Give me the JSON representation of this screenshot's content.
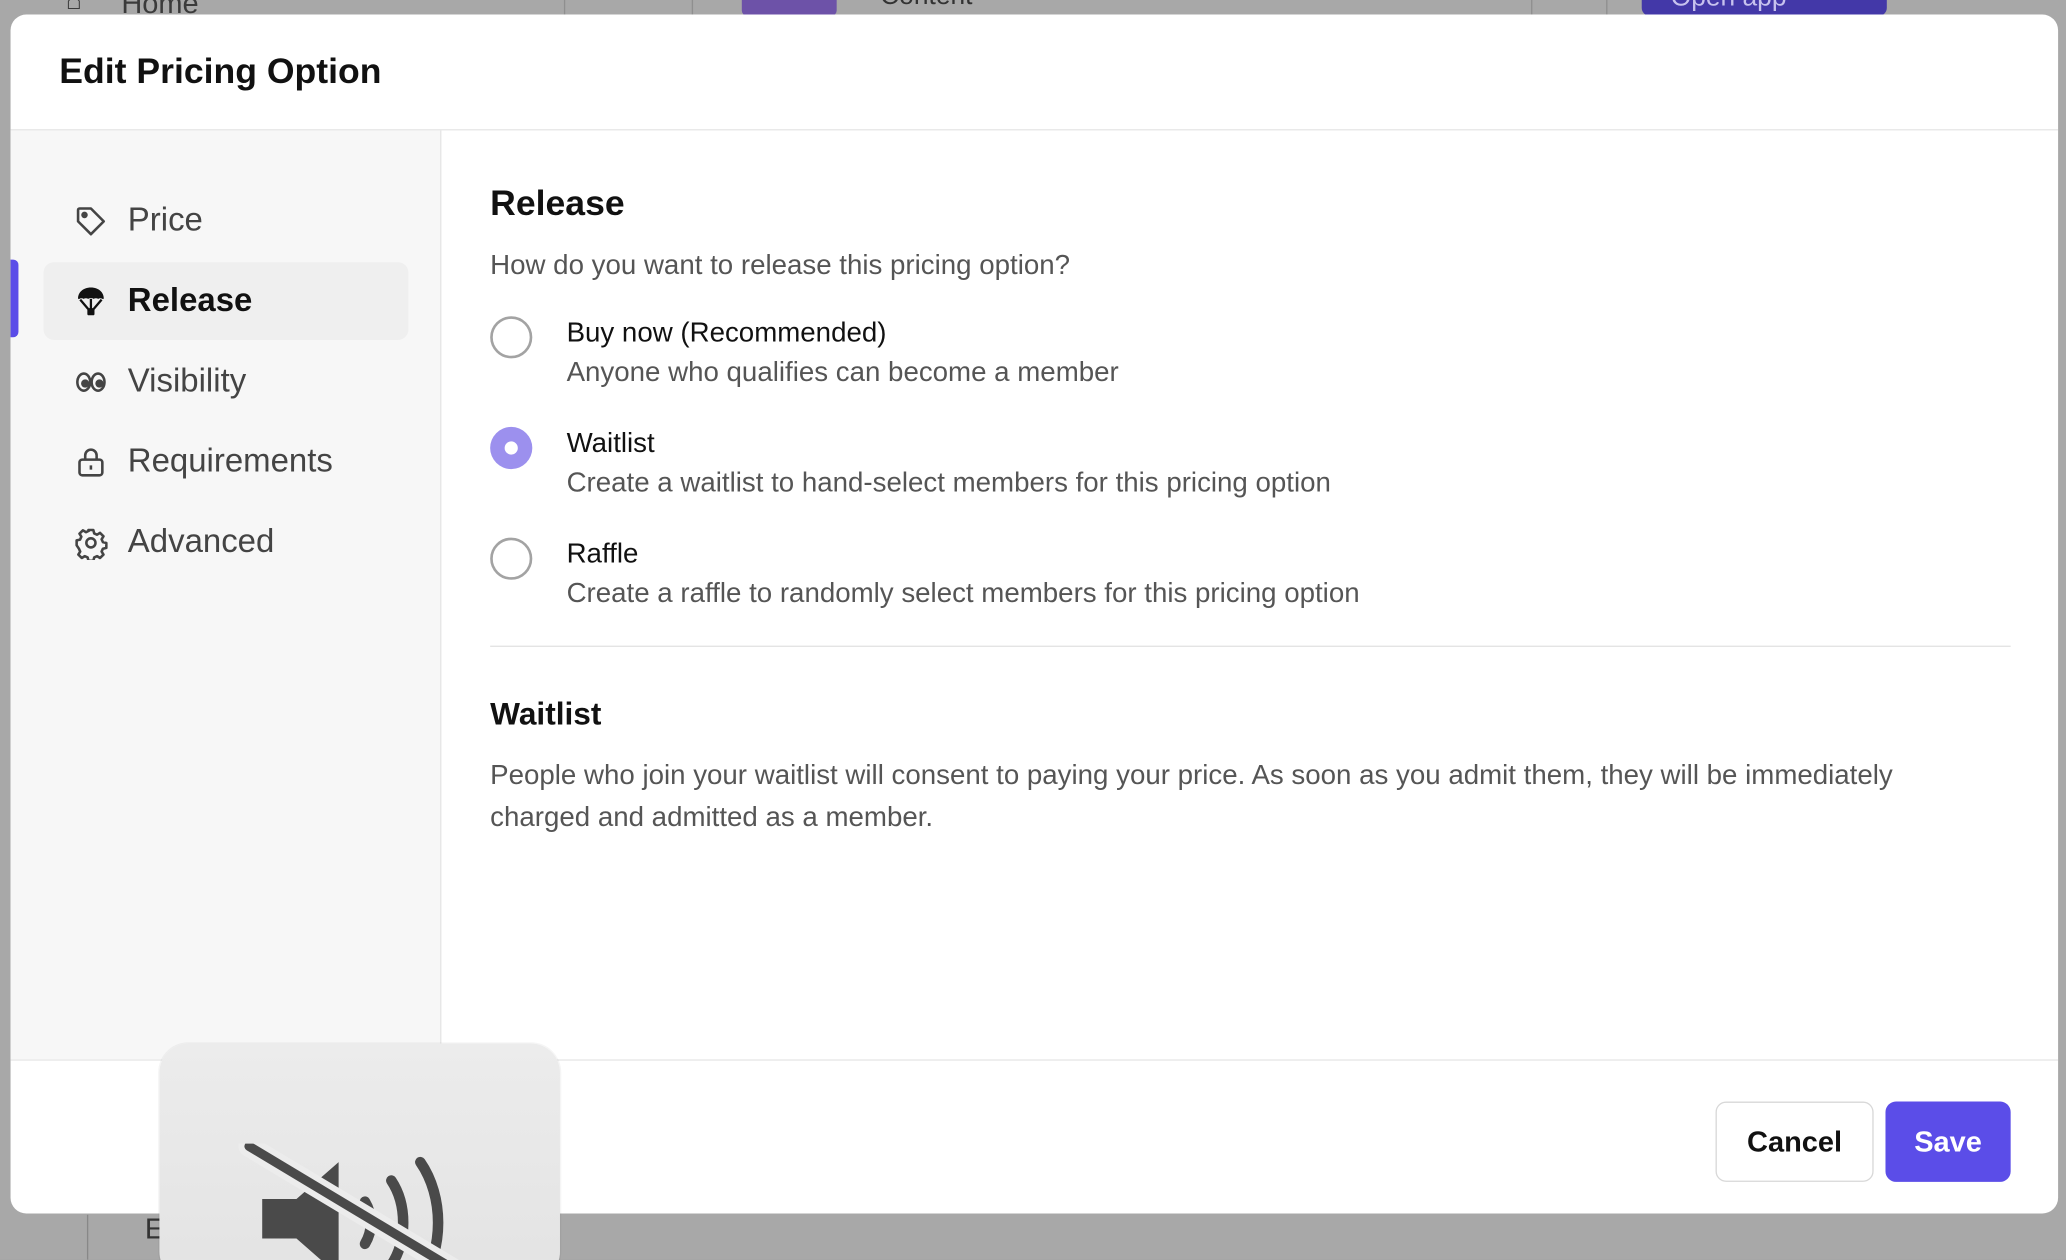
{
  "background": {
    "home_label": "Home",
    "content_label": "Content",
    "open_app_label": "Open app",
    "bottom_letter": "E"
  },
  "modal": {
    "title": "Edit Pricing Option"
  },
  "sidebar": {
    "items": [
      {
        "label": "Price",
        "icon": "tag-icon",
        "active": false
      },
      {
        "label": "Release",
        "icon": "parachute-icon",
        "active": true
      },
      {
        "label": "Visibility",
        "icon": "eyes-icon",
        "active": false
      },
      {
        "label": "Requirements",
        "icon": "lock-icon",
        "active": false
      },
      {
        "label": "Advanced",
        "icon": "gear-icon",
        "active": false
      }
    ]
  },
  "release": {
    "title": "Release",
    "subtitle": "How do you want to release this pricing option?",
    "options": [
      {
        "title": "Buy now (Recommended)",
        "description": "Anyone who qualifies can become a member",
        "selected": false
      },
      {
        "title": "Waitlist",
        "description": "Create a waitlist to hand-select members for this pricing option",
        "selected": true
      },
      {
        "title": "Raffle",
        "description": "Create a raffle to randomly select members for this pricing option",
        "selected": false
      }
    ]
  },
  "info": {
    "title": "Waitlist",
    "text": "People who join your waitlist will consent to paying your price. As soon as you admit them, they will be immediately charged and admitted as a member."
  },
  "footer": {
    "cancel_label": "Cancel",
    "save_label": "Save"
  },
  "colors": {
    "accent": "#5b4de8",
    "radio_selected": "#9c90ee"
  },
  "hud": {
    "icon": "speaker-muted-icon"
  }
}
